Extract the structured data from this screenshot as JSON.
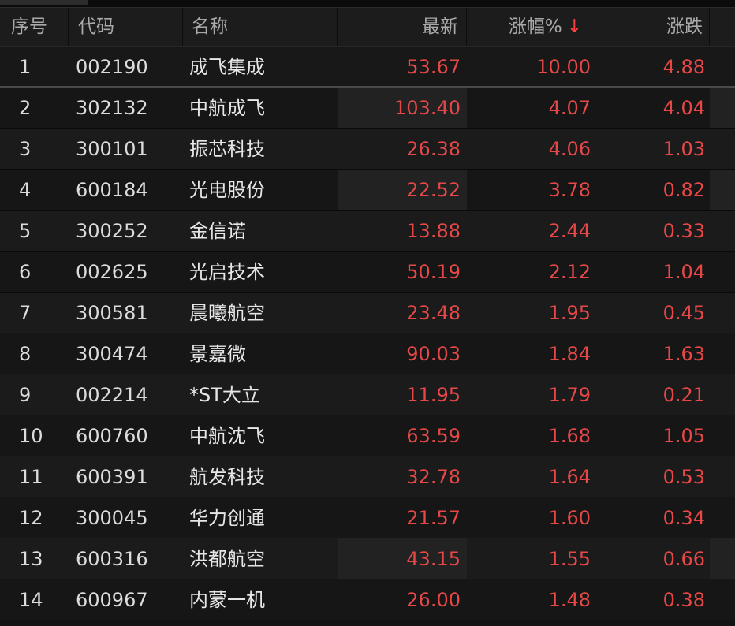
{
  "header": {
    "index": "序号",
    "code": "代码",
    "name": "名称",
    "latest": "最新",
    "change_pct": "涨幅%",
    "sort_indicator": "↓",
    "change": "涨跌"
  },
  "colors": {
    "up": "#e64848",
    "sort_arrow": "#ff4040",
    "header_text": "#a9a9a9",
    "text": "#dcdcdc"
  },
  "rows": [
    {
      "index": "1",
      "code": "002190",
      "name": "成飞集成",
      "latest": "53.67",
      "change_pct": "10.00",
      "change": "4.88"
    },
    {
      "index": "2",
      "code": "302132",
      "name": "中航成飞",
      "latest": "103.40",
      "change_pct": "4.07",
      "change": "4.04"
    },
    {
      "index": "3",
      "code": "300101",
      "name": "振芯科技",
      "latest": "26.38",
      "change_pct": "4.06",
      "change": "1.03"
    },
    {
      "index": "4",
      "code": "600184",
      "name": "光电股份",
      "latest": "22.52",
      "change_pct": "3.78",
      "change": "0.82"
    },
    {
      "index": "5",
      "code": "300252",
      "name": "金信诺",
      "latest": "13.88",
      "change_pct": "2.44",
      "change": "0.33"
    },
    {
      "index": "6",
      "code": "002625",
      "name": "光启技术",
      "latest": "50.19",
      "change_pct": "2.12",
      "change": "1.04"
    },
    {
      "index": "7",
      "code": "300581",
      "name": "晨曦航空",
      "latest": "23.48",
      "change_pct": "1.95",
      "change": "0.45"
    },
    {
      "index": "8",
      "code": "300474",
      "name": "景嘉微",
      "latest": "90.03",
      "change_pct": "1.84",
      "change": "1.63"
    },
    {
      "index": "9",
      "code": "002214",
      "name": "*ST大立",
      "latest": "11.95",
      "change_pct": "1.79",
      "change": "0.21"
    },
    {
      "index": "10",
      "code": "600760",
      "name": "中航沈飞",
      "latest": "63.59",
      "change_pct": "1.68",
      "change": "1.05"
    },
    {
      "index": "11",
      "code": "600391",
      "name": "航发科技",
      "latest": "32.78",
      "change_pct": "1.64",
      "change": "0.53"
    },
    {
      "index": "12",
      "code": "300045",
      "name": "华力创通",
      "latest": "21.57",
      "change_pct": "1.60",
      "change": "0.34"
    },
    {
      "index": "13",
      "code": "600316",
      "name": "洪都航空",
      "latest": "43.15",
      "change_pct": "1.55",
      "change": "0.66"
    },
    {
      "index": "14",
      "code": "600967",
      "name": "内蒙一机",
      "latest": "26.00",
      "change_pct": "1.48",
      "change": "0.38"
    }
  ]
}
